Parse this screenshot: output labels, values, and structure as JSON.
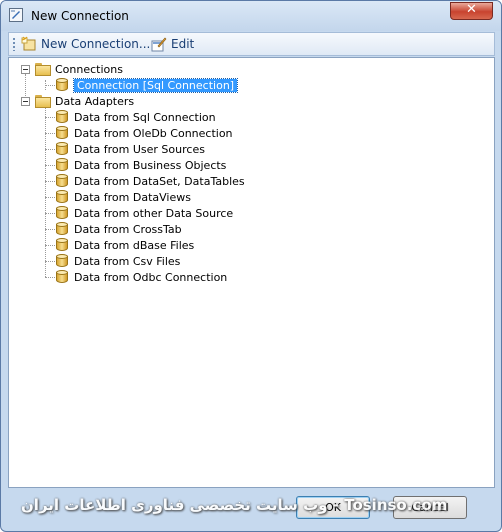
{
  "window": {
    "title": "New Connection",
    "close_label": "✕"
  },
  "toolbar": {
    "new_connection_label": "New Connection...",
    "edit_label": "Edit"
  },
  "tree": {
    "connections": {
      "label": "Connections",
      "children": [
        "Connection [Sql Connection]"
      ]
    },
    "data_adapters": {
      "label": "Data Adapters",
      "children": [
        "Data from Sql Connection",
        "Data from OleDb Connection",
        "Data from User Sources",
        "Data from Business Objects",
        "Data from DataSet, DataTables",
        "Data from DataViews",
        "Data from other Data Source",
        "Data from CrossTab",
        "Data from dBase Files",
        "Data from Csv Files",
        "Data from Odbc Connection"
      ]
    }
  },
  "buttons": {
    "ok_label": "OK",
    "cancel_label": "Cancel"
  },
  "watermark": "وب سایت تخصصی فناوری اطلاعات ایران - Tosinso.com",
  "colors": {
    "selection": "#3399ff",
    "window_frame": "#c6d9ee",
    "close_button": "#c8432f"
  },
  "icons": [
    "form-icon",
    "new-connection-icon",
    "edit-icon",
    "folder-icon",
    "database-icon",
    "close-icon"
  ]
}
